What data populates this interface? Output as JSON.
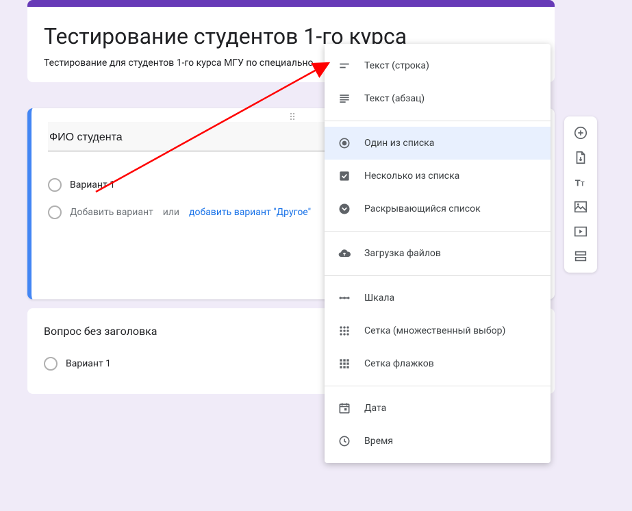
{
  "header": {
    "title": "Тестирование студентов 1-го курса",
    "description": "Тестирование для студентов 1-го курса МГУ по специально"
  },
  "question1": {
    "title": "ФИО студента",
    "option1": "Вариант 1",
    "add_option": "Добавить вариант",
    "or": "или",
    "add_other": "добавить вариант \"Другое\""
  },
  "question2": {
    "title": "Вопрос без заголовка",
    "option1": "Вариант 1"
  },
  "menu": {
    "short_text": "Текст (строка)",
    "paragraph": "Текст (абзац)",
    "radio": "Один из списка",
    "checkbox": "Несколько из списка",
    "dropdown": "Раскрывающийся список",
    "file_upload": "Загрузка файлов",
    "scale": "Шкала",
    "grid_radio": "Сетка (множественный выбор)",
    "grid_check": "Сетка флажков",
    "date": "Дата",
    "time": "Время"
  }
}
